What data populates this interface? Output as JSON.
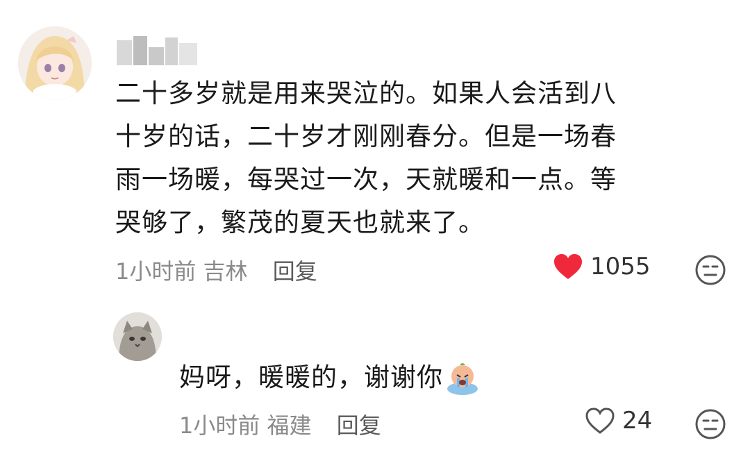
{
  "comment": {
    "lines": [
      "二十多岁就是用来哭泣的。如果人会活到八",
      "十岁的话，二十岁才刚刚春分。但是一场春",
      "雨一场暖，每哭过一次，天就暖和一点。等",
      "哭够了，繁茂的夏天也就来了。"
    ],
    "time": "1小时前",
    "location": "吉林",
    "reply_label": "回复",
    "likes": "1055",
    "liked": true
  },
  "reply": {
    "text": "妈呀，暖暖的，谢谢你",
    "emoji": "crying-face-emoji",
    "time": "1小时前",
    "location": "福建",
    "reply_label": "回复",
    "likes": "24",
    "liked": false
  },
  "colors": {
    "like_active": "#f0283c",
    "meta_gray": "#8a8a8a"
  }
}
